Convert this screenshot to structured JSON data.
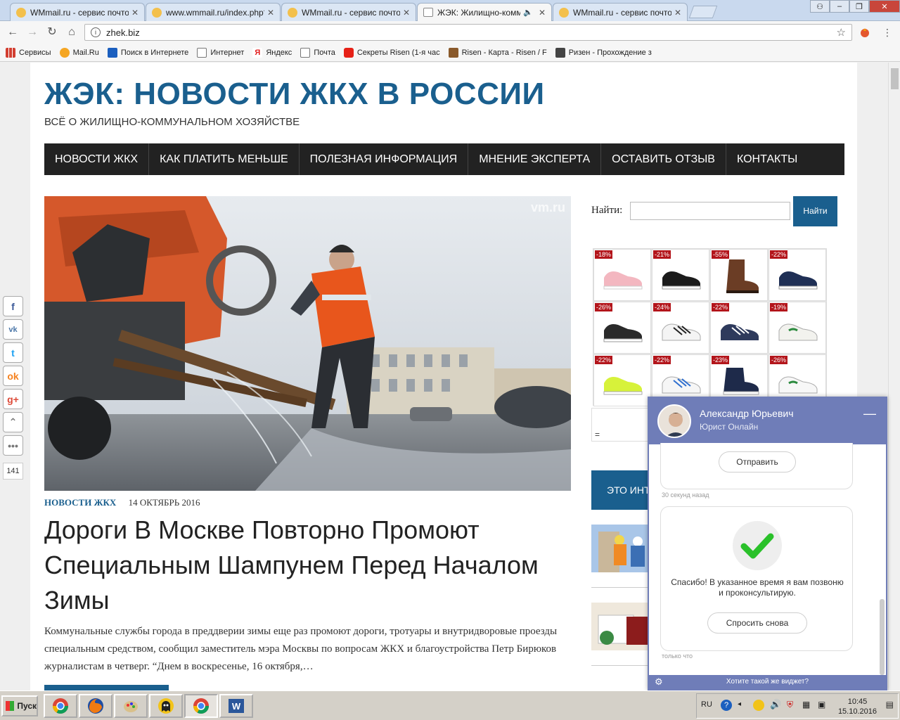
{
  "browser": {
    "tabs": [
      {
        "label": "WMmail.ru - сервис почтов",
        "active": false
      },
      {
        "label": "www.wmmail.ru/index.php?",
        "active": false
      },
      {
        "label": "WMmail.ru - сервис почтов",
        "active": false
      },
      {
        "label": "ЖЭК: Жилищно-комму",
        "active": true
      },
      {
        "label": "WMmail.ru - сервис почтов",
        "active": false
      }
    ],
    "url": "zhek.biz",
    "bookmarks": [
      {
        "label": "Сервисы",
        "color": "#d23f31"
      },
      {
        "label": "Mail.Ru",
        "color": "#f5a623"
      },
      {
        "label": "Поиск в Интернете",
        "color": "#1b5fbf"
      },
      {
        "label": "Интернет",
        "color": "#ffffff"
      },
      {
        "label": "Яндекс",
        "color": "#e21b1b"
      },
      {
        "label": "Почта",
        "color": "#ffffff"
      },
      {
        "label": "Секреты Risen (1-я час",
        "color": "#e62117"
      },
      {
        "label": "Risen - Карта - Risen / F",
        "color": "#8a5a2b"
      },
      {
        "label": "Ризен - Прохождение з",
        "color": "#444444"
      }
    ]
  },
  "site": {
    "title": "ЖЭК: НОВОСТИ ЖКХ В РОССИИ",
    "subtitle": "ВСЁ О ЖИЛИЩНО-КОММУНАЛЬНОМ ХОЗЯЙСТВЕ",
    "nav": [
      "НОВОСТИ ЖКХ",
      "КАК ПЛАТИТЬ МЕНЬШЕ",
      "ПОЛЕЗНАЯ ИНФОРМАЦИЯ",
      "МНЕНИЕ ЭКСПЕРТА",
      "ОСТАВИТЬ ОТЗЫВ",
      "КОНТАКТЫ"
    ],
    "watermark": "vm.ru",
    "accent": "#1a5f8e"
  },
  "article": {
    "category": "НОВОСТИ ЖКХ",
    "date": "14 ОКТЯБРЬ 2016",
    "headline": "Дороги В Москве Повторно Промоют Специальным Шампунем Перед Началом Зимы",
    "excerpt": "Коммунальные службы города в преддверии зимы еще раз промоют дороги, тротуары и внутридворовые проезды специальным средством, сообщил заместитель мэра Москвы по вопросам ЖКХ и благоустройства Петр Бирюков журналистам в четверг. “Днем в воскресенье, 16 октября,…"
  },
  "sidebar": {
    "search_label": "Найти:",
    "search_button": "Найти",
    "ads": [
      "-18%",
      "-21%",
      "-55%",
      "-22%",
      "-26%",
      "-24%",
      "-22%",
      "-19%",
      "-22%",
      "-22%",
      "-23%",
      "-26%"
    ],
    "ad_footer": "=",
    "promo": "ЭТО ИНТ"
  },
  "social": {
    "count": "141"
  },
  "chat": {
    "name": "Александр Юрьевич",
    "role": "Юрист Онлайн",
    "send": "Отправить",
    "ago1": "30 секунд назад",
    "thanks": "Спасибо! В указанное время я вам позвоню и проконсультирую.",
    "ask_again": "Спросить снова",
    "ago2": "только что",
    "footer": "Хотите такой же виджет?"
  },
  "taskbar": {
    "start": "Пуск",
    "lang": "RU",
    "time": "10:45",
    "date": "15.10.2016"
  }
}
